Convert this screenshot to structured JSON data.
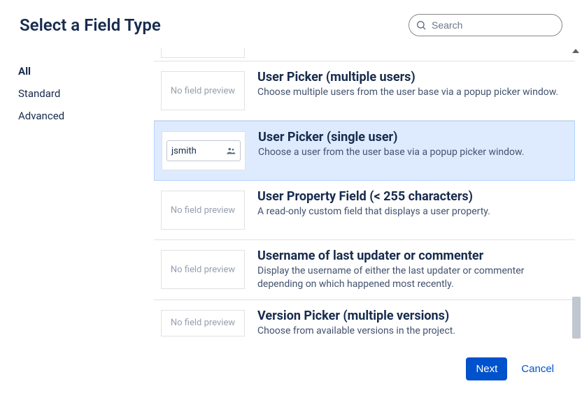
{
  "header": {
    "title": "Select a Field Type",
    "search_placeholder": "Search"
  },
  "sidebar": {
    "items": [
      {
        "label": "All",
        "active": true
      },
      {
        "label": "Standard",
        "active": false
      },
      {
        "label": "Advanced",
        "active": false
      }
    ]
  },
  "preview": {
    "no_preview_label": "No field preview",
    "user_sample_value": "jsmith"
  },
  "fields": [
    {
      "title": "User Picker (multiple users)",
      "desc": "Choose multiple users from the user base via a popup picker window.",
      "preview": "none",
      "selected": false
    },
    {
      "title": "User Picker (single user)",
      "desc": "Choose a user from the user base via a popup picker window.",
      "preview": "user",
      "selected": true
    },
    {
      "title": "User Property Field (< 255 characters)",
      "desc": "A read-only custom field that displays a user property.",
      "preview": "none",
      "selected": false
    },
    {
      "title": "Username of last updater or commenter",
      "desc": "Display the username of either the last updater or commenter depending on which happened most recently.",
      "preview": "none",
      "selected": false
    },
    {
      "title": "Version Picker (multiple versions)",
      "desc": "Choose from available versions in the project.",
      "preview": "none",
      "selected": false
    }
  ],
  "footer": {
    "next_label": "Next",
    "cancel_label": "Cancel"
  }
}
